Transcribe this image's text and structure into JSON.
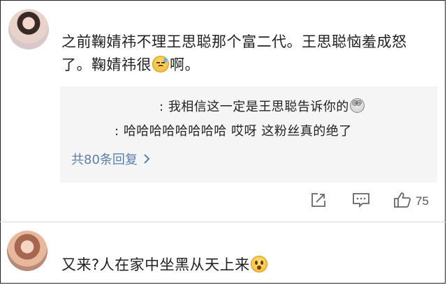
{
  "comments": [
    {
      "text_a": "之前鞠婧祎不理王思聪那个富二代。王思聪恼羞成怒了。鞠婧祎很",
      "emoji_a": "sad-face-emoji",
      "text_b": "啊。",
      "replies": [
        {
          "prefix": ":",
          "text": "我相信这一定是王思聪告诉你的",
          "emoji": "dizzy-face-emoji"
        },
        {
          "prefix": ":",
          "text": "哈哈哈哈哈哈哈哈 哎呀 这粉丝真的绝了"
        }
      ],
      "more_replies": "共80条回复",
      "more_icon": "chevron-right-icon",
      "actions": {
        "share_icon": "share-icon",
        "comment_icon": "comment-icon",
        "like_icon": "thumbs-up-icon",
        "like_count": "75"
      }
    },
    {
      "text_a": "又来?人在家中坐黑从天上来",
      "emoji_a": "scared-face-emoji"
    }
  ],
  "colors": {
    "link": "#5a7fa8",
    "reply_bg": "#f5f5f5",
    "text": "#222222",
    "icon": "#666666"
  }
}
